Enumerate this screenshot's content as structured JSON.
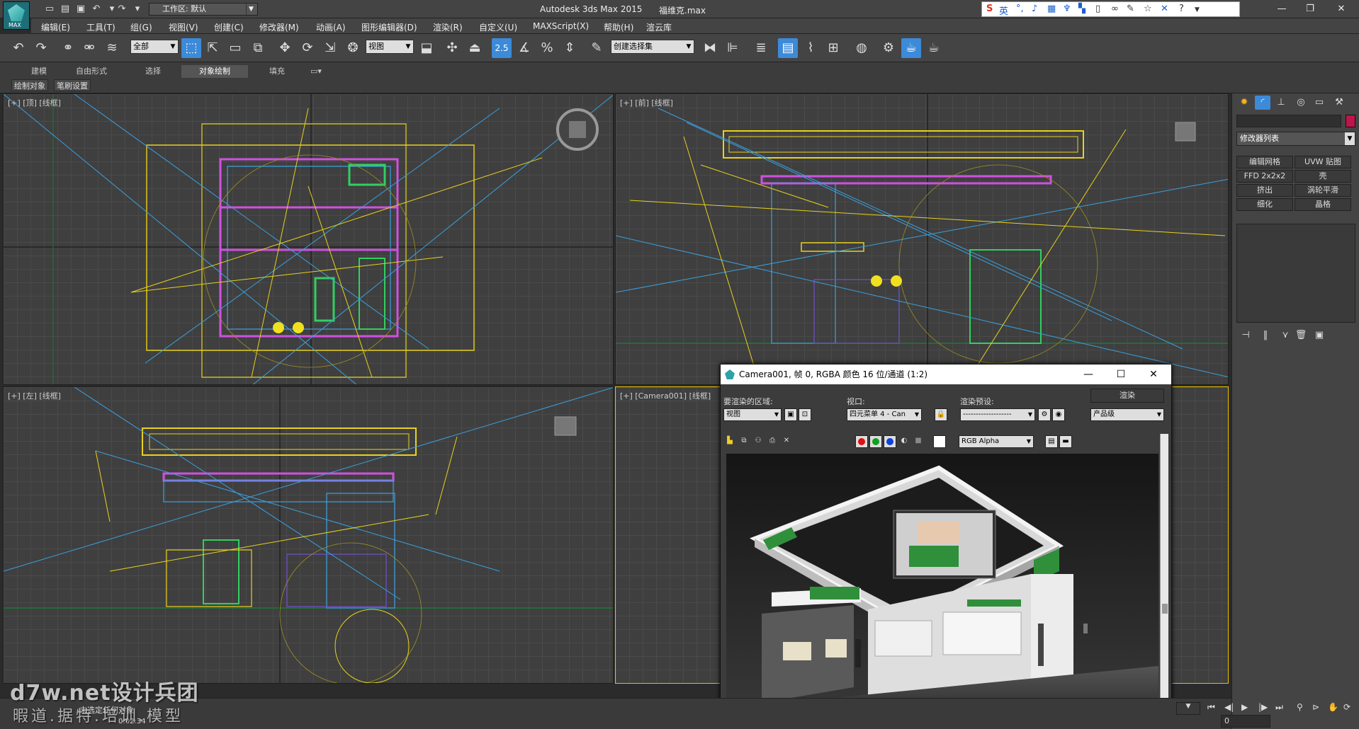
{
  "app": {
    "logo_text": "MAX",
    "workspace": "工作区: 默认",
    "window_title": "Autodesk 3ds Max  2015",
    "file_name": "福维克.max"
  },
  "ime": {
    "lang": "英"
  },
  "menu": {
    "items": [
      "编辑(E)",
      "工具(T)",
      "组(G)",
      "视图(V)",
      "创建(C)",
      "修改器(M)",
      "动画(A)",
      "图形编辑器(D)",
      "渲染(R)",
      "自定义(U)",
      "MAXScript(X)",
      "帮助(H)",
      "渲云库"
    ]
  },
  "toolbar": {
    "selection_filter": "全部",
    "coord_system": "视图",
    "snap_label": "2.5",
    "named_selection": "创建选择集"
  },
  "ribbon": {
    "tabs": [
      "建模",
      "自由形式",
      "选择",
      "对象绘制",
      "填充"
    ],
    "subtabs": [
      "绘制对象",
      "笔刷设置"
    ]
  },
  "viewports": {
    "top": "[+] [顶] [线框]",
    "front": "[+] [前] [线框]",
    "left": "[+] [左] [线框]",
    "camera": "[+] [Camera001] [线框]"
  },
  "command_panel": {
    "modifier_list": "修改器列表",
    "buttons": [
      "编辑网格",
      "UVW 贴图",
      "FFD 2x2x2",
      "壳",
      "挤出",
      "涡轮平滑",
      "细化",
      "晶格"
    ]
  },
  "render_window": {
    "title": "Camera001, 帧 0, RGBA 颜色 16 位/通道 (1:2)",
    "area_label": "要渲染的区域:",
    "area_value": "视图",
    "viewport_label": "视口:",
    "viewport_value": "四元菜单 4 - Can",
    "preset_label": "渲染预设:",
    "preset_value": "-------------------",
    "render_button": "渲染",
    "quality_value": "产品级",
    "channel_value": "RGB Alpha"
  },
  "status": {
    "message": "未选定任何对象",
    "time": "0:02:34",
    "frame": "0"
  },
  "watermark": {
    "line1": "d7w.net设计兵团",
    "line2": "暇道.据特.培训.模型"
  },
  "colors": {
    "accent": "#3c8ad8",
    "wire_yellow": "#e8d21c",
    "wire_blue": "#3aa0e0",
    "wire_magenta": "#d050e0",
    "wire_green": "#30d060",
    "active_border": "#e8c000"
  }
}
